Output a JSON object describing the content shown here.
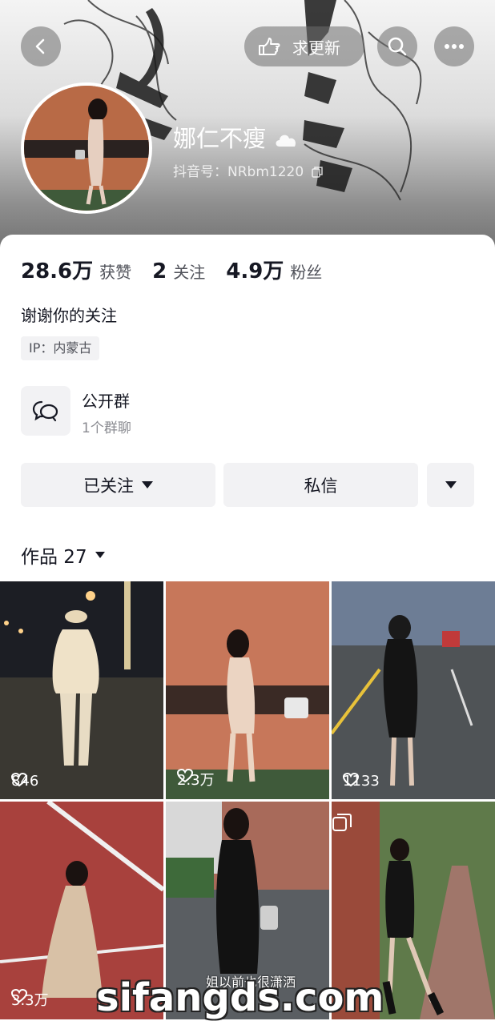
{
  "header": {
    "request_update_label": "求更新",
    "nickname": "娜仁不瘦",
    "douyin_id": "抖音号：NRbm1220"
  },
  "stats": [
    {
      "value": "28.6万",
      "label": "获赞"
    },
    {
      "value": "2",
      "label": "关注"
    },
    {
      "value": "4.9万",
      "label": "粉丝"
    }
  ],
  "profile": {
    "bio": "谢谢你的关注",
    "ip": "IP：内蒙古"
  },
  "group": {
    "title": "公开群",
    "subtitle": "1个群聊"
  },
  "actions": {
    "followed_label": "已关注",
    "message_label": "私信"
  },
  "works": {
    "label": "作品 27",
    "items": [
      {
        "likes": "846"
      },
      {
        "likes": "2.3万"
      },
      {
        "likes": "1133"
      },
      {
        "likes": "3.3万"
      },
      {
        "likes": "",
        "caption": "姐以前也很潇洒"
      },
      {
        "likes": ""
      }
    ]
  },
  "watermark": "sifangds.com",
  "colors": {
    "accent_text": "#161823",
    "button_bg": "#f2f2f4",
    "muted_text": "#8a8b91"
  }
}
